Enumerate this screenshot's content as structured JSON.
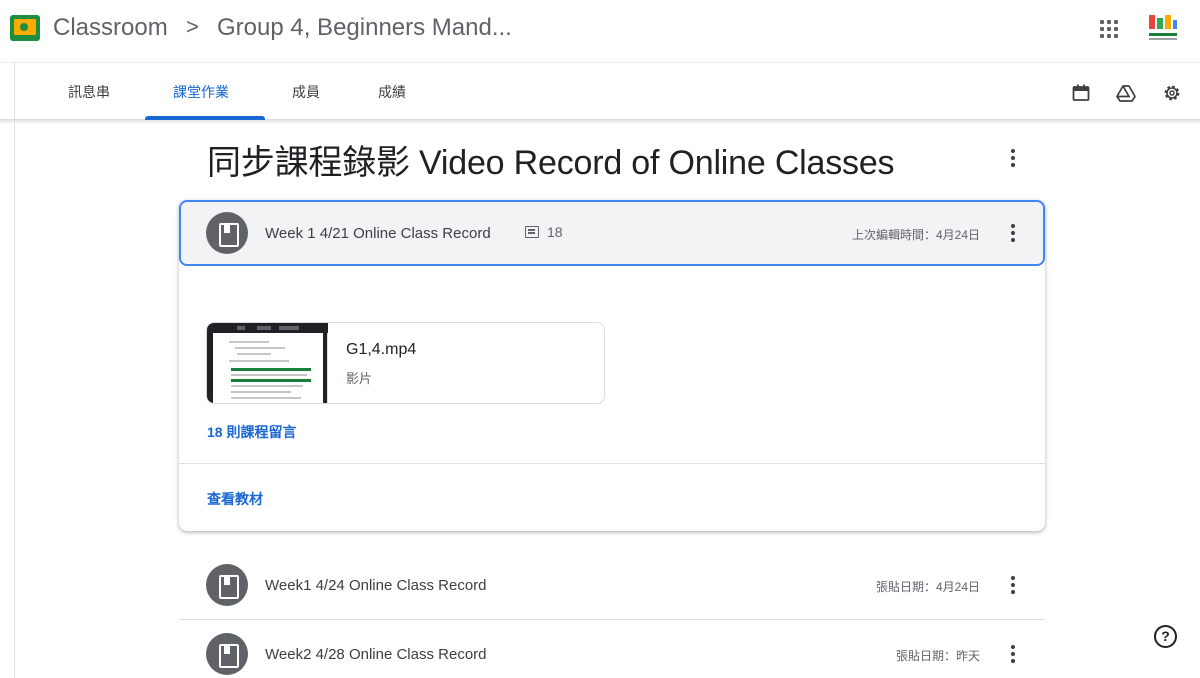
{
  "header": {
    "app_title": "Classroom",
    "separator": ">",
    "class_title": "Group 4, Beginners Mand..."
  },
  "tabs": [
    {
      "label": "訊息串",
      "active": false
    },
    {
      "label": "課堂作業",
      "active": true
    },
    {
      "label": "成員",
      "active": false
    },
    {
      "label": "成績",
      "active": false
    }
  ],
  "toolbar_icons": [
    "calendar-icon",
    "drive-icon",
    "settings-icon"
  ],
  "topic": {
    "title": "同步課程錄影 Video Record of Online Classes"
  },
  "expanded_item": {
    "title": "Week 1 4/21 Online Class Record",
    "comment_count": "18",
    "meta": "上次編輯時間：4月24日",
    "attachment": {
      "name": "G1,4.mp4",
      "type": "影片"
    },
    "comments_link": "18 則課程留言",
    "view_link": "查看教材"
  },
  "items": [
    {
      "title": "Week1 4/24 Online Class Record",
      "meta": "張貼日期：4月24日"
    },
    {
      "title": "Week2 4/28 Online Class Record",
      "meta": "張貼日期：昨天"
    }
  ],
  "help": "?",
  "colors": {
    "accent": "#1967d2",
    "focus_border": "#4285f4",
    "icon_circle": "#5f6368",
    "logo_green": "#1e8e3e",
    "logo_yellow": "#f9ab00"
  }
}
